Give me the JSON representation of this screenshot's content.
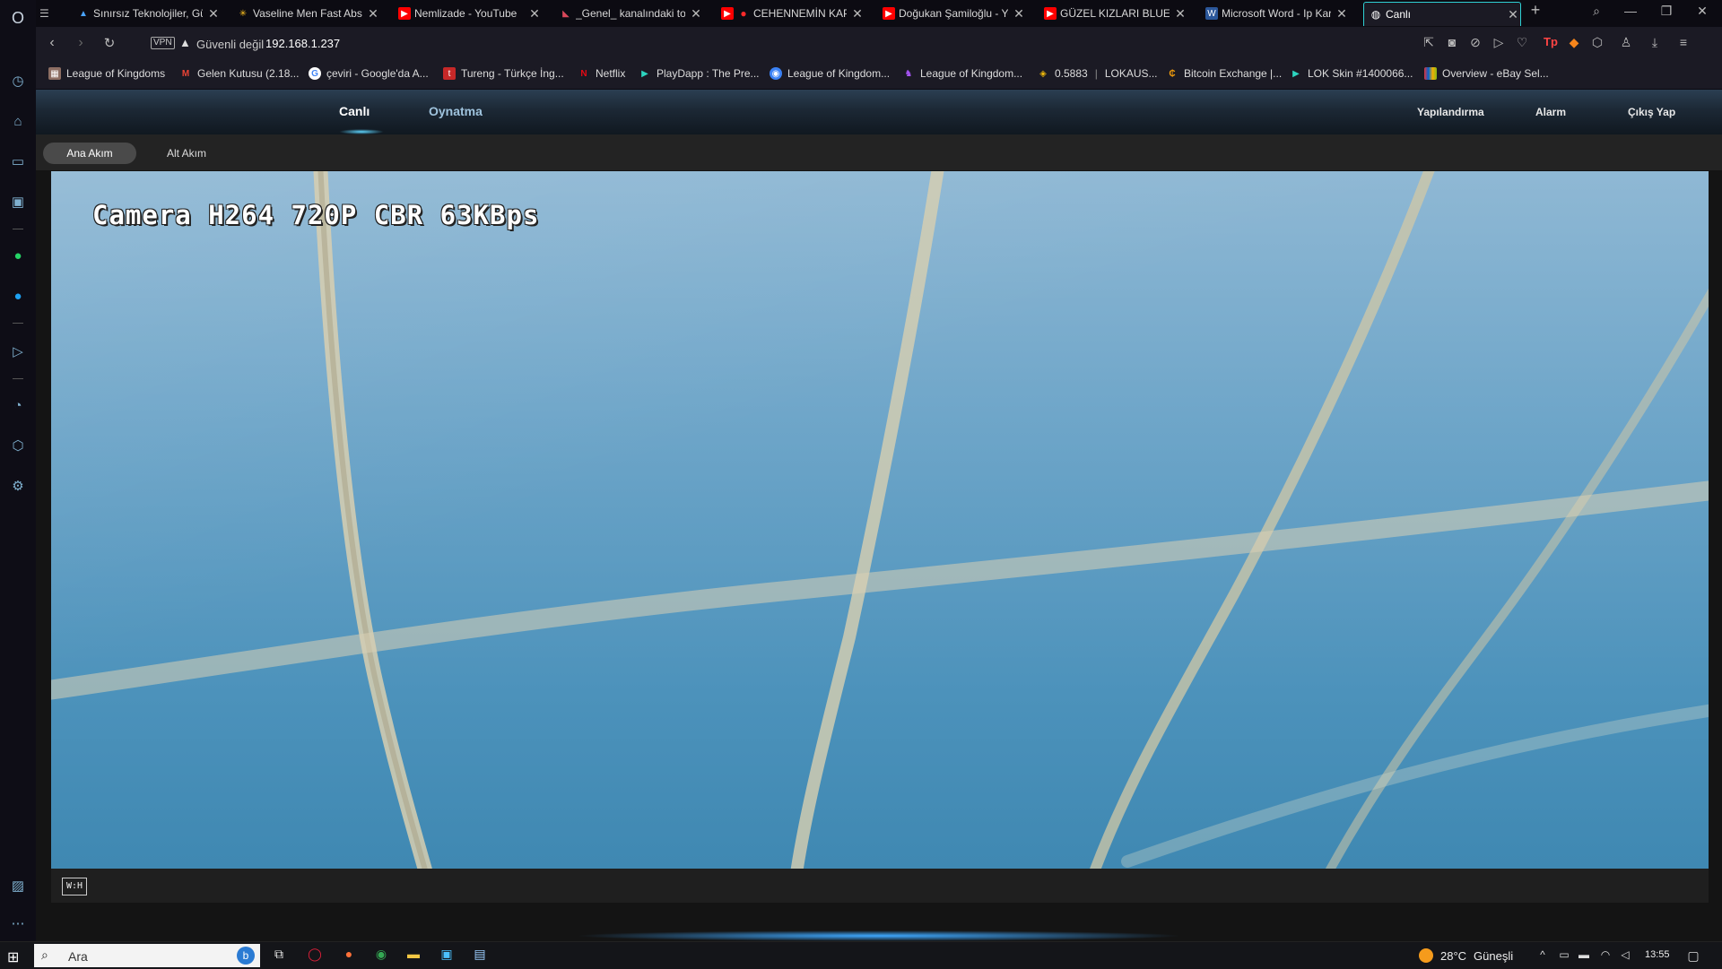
{
  "browser": {
    "tabs": [
      {
        "title": "Sınırsız Teknolojiler, Gü",
        "icon": "pointer-icon",
        "color": "#4aa3ff"
      },
      {
        "title": "Vaseline Men Fast Abso",
        "icon": "walmart-icon",
        "color": "#ffc220"
      },
      {
        "title": "Nemlizade - YouTube",
        "icon": "youtube-icon",
        "color": "#ff0000"
      },
      {
        "title": "_Genel_ kanalındaki top",
        "icon": "pin-icon",
        "color": "#d9485a"
      },
      {
        "title": "CEHENNEMİN KAPI",
        "icon": "youtube-icon",
        "color": "#ff0000"
      },
      {
        "title": "Doğukan Şamiloğlu - Yo",
        "icon": "youtube-icon",
        "color": "#ff0000"
      },
      {
        "title": "GÜZEL KIZLARI BLUETO",
        "icon": "youtube-icon",
        "color": "#ff0000"
      },
      {
        "title": "Microsoft Word - Ip Kar",
        "icon": "document-icon",
        "color": "#2b579a"
      },
      {
        "title": "Canlı",
        "icon": "globe-icon",
        "color": "#ffffff",
        "active": true
      }
    ],
    "new_tab_symbol": "+",
    "address": {
      "vpn_label": "VPN",
      "security_text": "Güvenli değil",
      "url": "192.168.1.237"
    },
    "bookmarks": [
      {
        "label": "League of Kingdoms",
        "icon": "lok-icon",
        "color": "#8d6e63"
      },
      {
        "label": "Gelen Kutusu (2.18...",
        "icon": "gmail-icon",
        "color": "#ea4335"
      },
      {
        "label": "çeviri - Google'da A...",
        "icon": "google-icon",
        "color": "#ffffff"
      },
      {
        "label": "Tureng - Türkçe İng...",
        "icon": "tureng-icon",
        "color": "#c62828"
      },
      {
        "label": "Netflix",
        "icon": "netflix-icon",
        "color": "#e50914"
      },
      {
        "label": "PlayDapp : The Pre...",
        "icon": "playdapp-icon",
        "color": "#2dd4bf"
      },
      {
        "label": "League of Kingdom...",
        "icon": "lok-icon",
        "color": "#3b82f6"
      },
      {
        "label": "League of Kingdom...",
        "icon": "lok-icon",
        "color": "#a855f7"
      },
      {
        "label": "0.5883",
        "icon": "binance-icon",
        "color": "#f0b90b"
      },
      {
        "label": "LOKAUS...",
        "icon": "",
        "color": ""
      },
      {
        "label": "Bitcoin Exchange |...",
        "icon": "bitcoin-icon",
        "color": "#f59e0b"
      },
      {
        "label": "LOK Skin #1400066...",
        "icon": "playdapp-icon",
        "color": "#2dd4bf"
      },
      {
        "label": "Overview - eBay Sel...",
        "icon": "ebay-icon",
        "color": "#e53238"
      }
    ]
  },
  "camera_app": {
    "nav_main": {
      "live": "Canlı",
      "playback": "Oynatma"
    },
    "nav_right": {
      "config": "Yapılandırma",
      "alarm": "Alarm",
      "logout": "Çıkış Yap"
    },
    "streams": {
      "main": "Ana Akım",
      "sub": "Alt Akım"
    },
    "osd_text": "Camera H264 720P CBR 63KBps",
    "fit_button": "W:H"
  },
  "taskbar": {
    "search_placeholder": "Ara",
    "weather": {
      "temp": "28°C",
      "condition": "Güneşli"
    },
    "clock": "13:55"
  },
  "colors": {
    "accent": "#2fd0d4",
    "app_nav": "#1c2835",
    "sky": "#4c92bb"
  }
}
